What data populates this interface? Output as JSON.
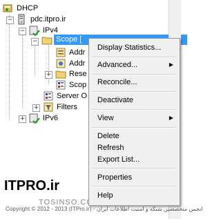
{
  "tree": {
    "root": "DHCP",
    "server": "pdc.itpro.ir",
    "ipv4": "IPv4",
    "scope_selected": "Scope [",
    "children": [
      "Addr",
      "Addr",
      "Rese",
      "Scop"
    ],
    "server_options": "Server O",
    "filters": "Filters",
    "ipv6": "IPv6"
  },
  "menu": {
    "items": [
      {
        "label": "Display Statistics...",
        "submenu": false
      },
      {
        "label": "Advanced...",
        "submenu": true
      },
      {
        "label": "Reconcile...",
        "submenu": false
      },
      {
        "label": "Deactivate",
        "submenu": false
      },
      {
        "label": "View",
        "submenu": true
      },
      {
        "label": "Delete",
        "submenu": false
      },
      {
        "label": "Refresh",
        "submenu": false
      },
      {
        "label": "Export List...",
        "submenu": false
      },
      {
        "label": "Properties",
        "submenu": false
      },
      {
        "label": "Help",
        "submenu": false
      }
    ]
  },
  "watermark": {
    "brand": "ITPRO.ir",
    "copyright": "Copyright © 2012 - 2013 (ITPro.ir) - انجمن متخصصین شبکه و امنیت اطلاعات ایران",
    "site": "TOSINSO.COM"
  },
  "colors": {
    "selection": "#3399ff",
    "menu_bg": "#f0f0f0"
  }
}
